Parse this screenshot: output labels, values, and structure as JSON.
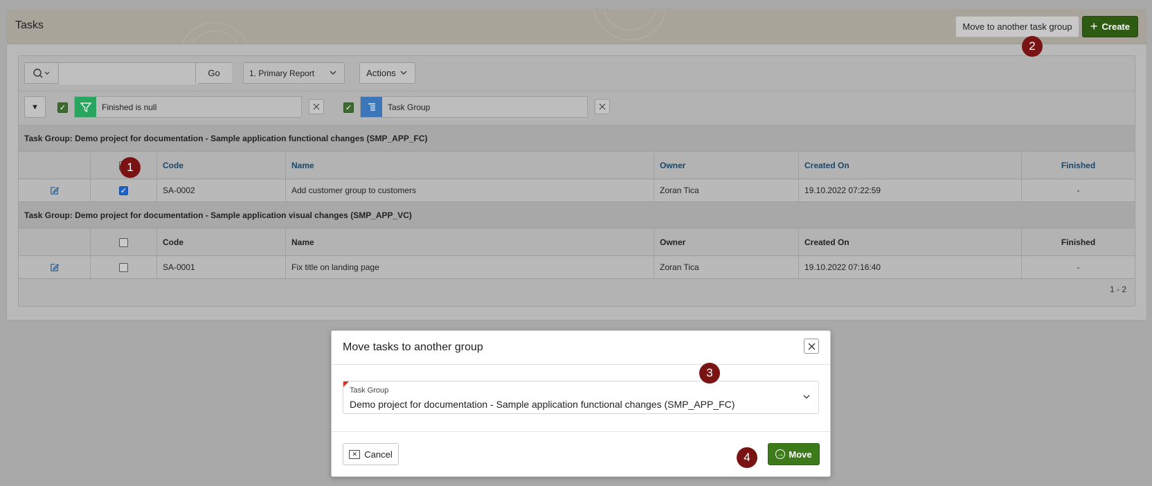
{
  "page": {
    "title": "Tasks"
  },
  "header_buttons": {
    "move_group_label": "Move to another task group",
    "create_label": "Create"
  },
  "toolbar": {
    "search_value": "",
    "go_label": "Go",
    "report_label": "1. Primary Report",
    "actions_label": "Actions"
  },
  "filters": [
    {
      "label": "Finished is null",
      "enabled": true,
      "color": "#2aa55f"
    },
    {
      "label": "Task Group",
      "enabled": true,
      "color": "#3b76b8"
    }
  ],
  "columns": [
    "Code",
    "Name",
    "Owner",
    "Created On",
    "Finished"
  ],
  "groups": [
    {
      "title": "Task Group: Demo project for documentation - Sample application functional changes (SMP_APP_FC)",
      "rows": [
        {
          "checked": true,
          "code": "SA-0002",
          "name": "Add customer group to customers",
          "owner": "Zoran Tica",
          "created_on": "19.10.2022 07:22:59",
          "finished": "-"
        }
      ]
    },
    {
      "title": "Task Group: Demo project for documentation - Sample application visual changes (SMP_APP_VC)",
      "rows": [
        {
          "checked": false,
          "code": "SA-0001",
          "name": "Fix title on landing page",
          "owner": "Zoran Tica",
          "created_on": "19.10.2022 07:16:40",
          "finished": "-"
        }
      ]
    }
  ],
  "pagination": "1 - 2",
  "dialog": {
    "title": "Move tasks to another group",
    "field_label": "Task Group",
    "field_value": "Demo project for documentation - Sample application functional changes (SMP_APP_FC)",
    "cancel_label": "Cancel",
    "move_label": "Move"
  },
  "markers": [
    "1",
    "2",
    "3",
    "4"
  ],
  "colors": {
    "create_button": "#2e5b12",
    "move_button": "#3d7a1a",
    "marker": "#7a1414",
    "header_link": "#17476b"
  }
}
